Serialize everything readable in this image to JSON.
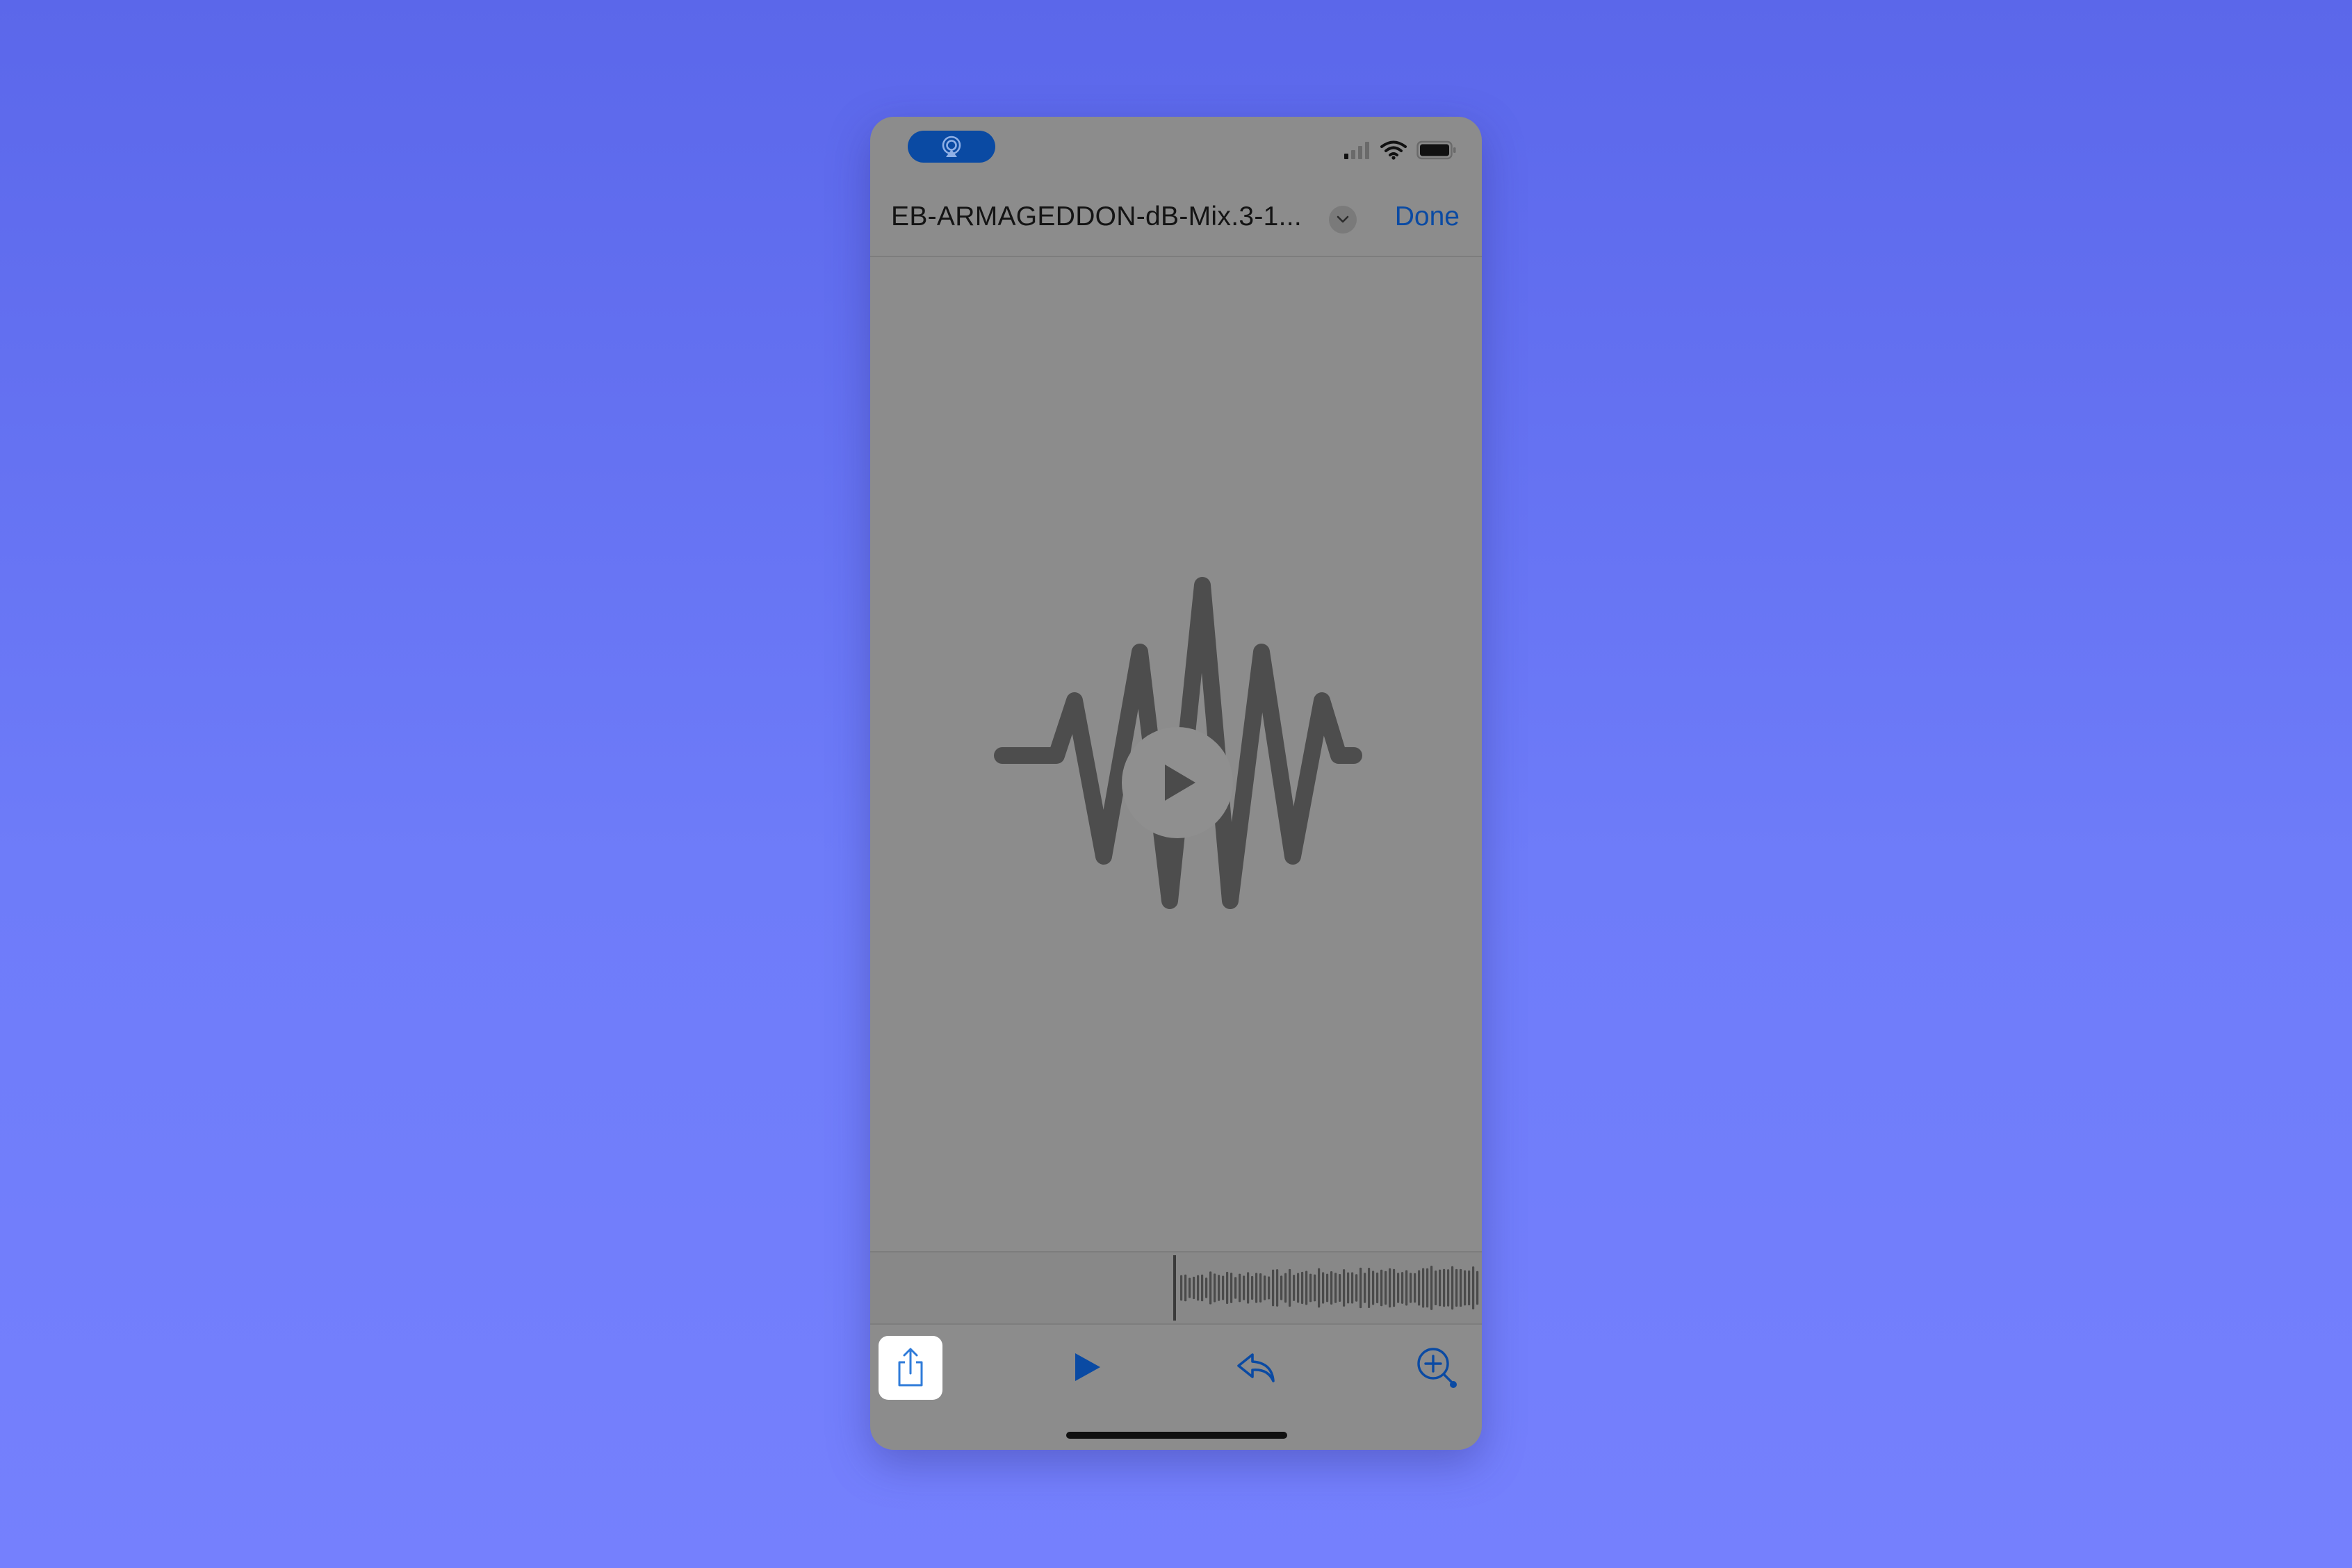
{
  "status_bar": {
    "airplay_pill_icon": "airplay-audio-icon",
    "signal_icon": "cellular-signal-icon",
    "wifi_icon": "wifi-icon",
    "battery_icon": "battery-icon"
  },
  "nav": {
    "title": "EB-ARMAGEDDON-dB-Mix.3-1...",
    "done_label": "Done",
    "chevron_icon": "chevron-down-icon"
  },
  "preview": {
    "artwork_icon": "audio-waveform-icon",
    "play_icon": "play-icon"
  },
  "toolbar": {
    "share_icon": "share-icon",
    "play_icon": "play-icon",
    "reply_icon": "reply-icon",
    "zoom_icon": "zoom-in-icon"
  },
  "colors": {
    "accent": "#0a4aa3",
    "background_top": "#5b67ea",
    "background_bottom": "#7580fd",
    "sheet": "#8c8c8c",
    "artwork": "#4d4d4d"
  }
}
